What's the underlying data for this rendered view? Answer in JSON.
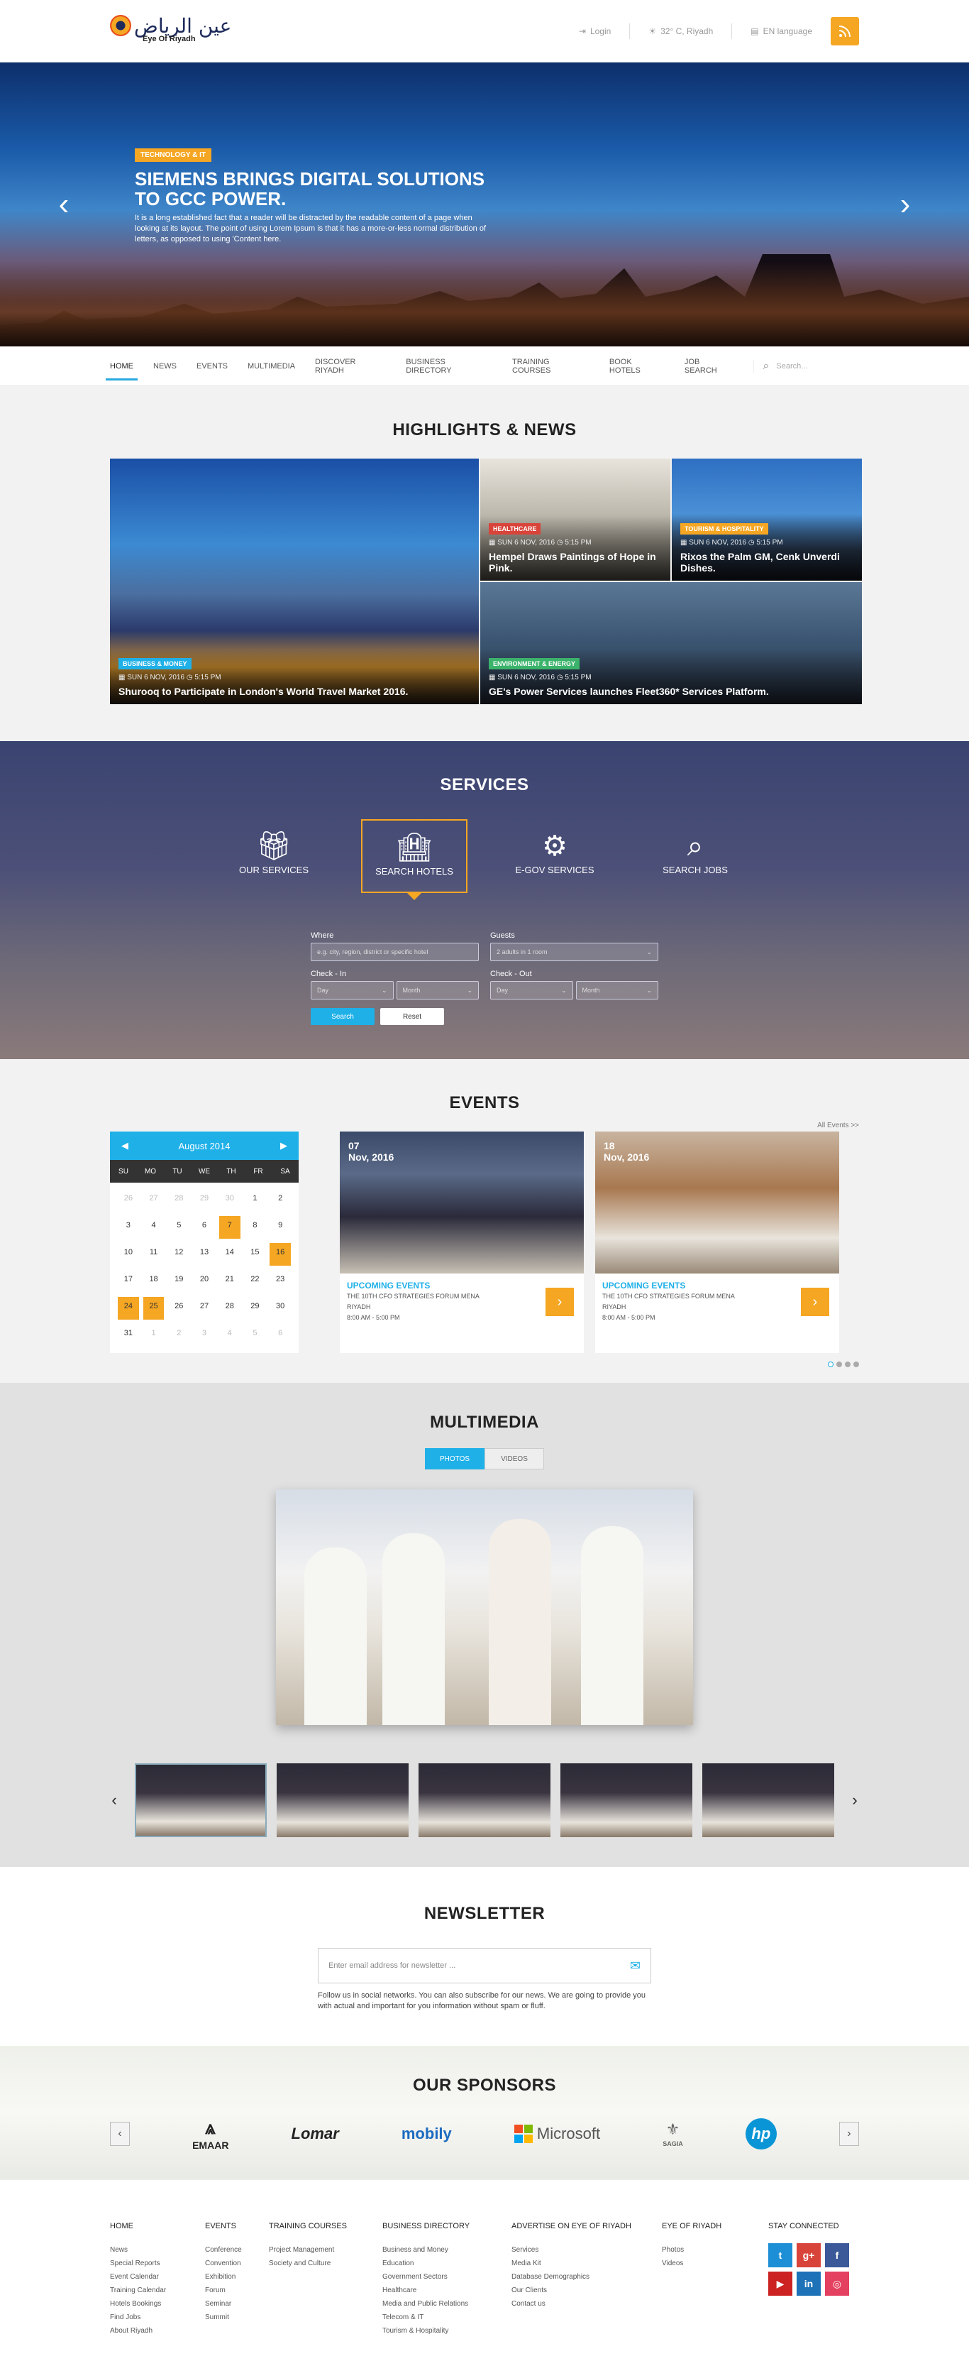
{
  "header": {
    "logo_ar": "عين الرياض",
    "logo_en": "Eye Of Riyadh",
    "login": "Login",
    "weather": "32° C, Riyadh",
    "language": "EN language"
  },
  "hero": {
    "tag": "Technology & IT",
    "title": "Siemens brings digital solutions to GCC power.",
    "text": "It is a long established fact that a reader will be distracted by the readable content of a page when looking at its layout. The point of using Lorem Ipsum is that it has a more-or-less normal distribution of letters, as opposed to using 'Content here."
  },
  "nav": {
    "items": [
      "Home",
      "News",
      "Events",
      "Multimedia",
      "Discover Riyadh",
      "Business Directory",
      "Training Courses",
      "Book Hotels",
      "Job Search"
    ],
    "search_placeholder": "Search..."
  },
  "highlights": {
    "title": "HIGHLIGHTS & NEWS",
    "tiles": [
      {
        "category": "Business & Money",
        "category_color": "#1fb0e8",
        "date": "SUN 6 NOV, 2016",
        "time": "5:15 PM",
        "headline": "Shurooq to Participate in London's World Travel Market 2016."
      },
      {
        "category": "Healthcare",
        "category_color": "#d9443a",
        "date": "SUN 6 NOV, 2016",
        "time": "5:15 PM",
        "headline": "Hempel Draws Paintings of Hope in Pink."
      },
      {
        "category": "Tourism & Hospitality",
        "category_color": "#f5a623",
        "date": "SUN 6 NOV, 2016",
        "time": "5:15 PM",
        "headline": "Rixos the Palm GM, Cenk Unverdi Dishes."
      },
      {
        "category": "Environment & Energy",
        "category_color": "#3bb36b",
        "date": "SUN 6 NOV, 2016",
        "time": "5:15 PM",
        "headline": "GE's Power Services launches Fleet360* Services Platform."
      }
    ]
  },
  "services": {
    "title": "SERVICES",
    "items": [
      "OUR SERVICES",
      "SEARCH HOTELS",
      "E-GOV SERVICES",
      "SEARCH JOBS"
    ],
    "form": {
      "where_label": "Where",
      "where_placeholder": "e.g. city, region, district or specific hotel",
      "guests_label": "Guests",
      "guests_value": "2 adults in 1 room",
      "checkin_label": "Check - In",
      "checkout_label": "Check - Out",
      "day": "Day",
      "month": "Month",
      "search": "Search",
      "reset": "Reset"
    }
  },
  "events": {
    "title": "EVENTS",
    "all_events": "All Events >>",
    "calendar": {
      "month": "August 2014",
      "dow": [
        "SU",
        "MO",
        "TU",
        "WE",
        "TH",
        "FR",
        "SA"
      ],
      "days": [
        "26",
        "27",
        "28",
        "29",
        "30",
        "1",
        "2",
        "3",
        "4",
        "5",
        "6",
        "7",
        "8",
        "9",
        "10",
        "11",
        "12",
        "13",
        "14",
        "15",
        "16",
        "17",
        "18",
        "19",
        "20",
        "21",
        "22",
        "23",
        "24",
        "25",
        "26",
        "27",
        "28",
        "29",
        "30",
        "31",
        "1",
        "2",
        "3",
        "4",
        "5",
        "6"
      ]
    },
    "cards": [
      {
        "date_day": "07",
        "date_rest": "Nov, 2016",
        "label": "UPCOMING EVENTS",
        "name": "THE 10TH CFO STRATEGIES FORUM MENA",
        "city": "RIYADH",
        "time": "8:00 AM - 5:00 PM"
      },
      {
        "date_day": "18",
        "date_rest": "Nov, 2016",
        "label": "UPCOMING EVENTS",
        "name": "THE 10TH CFO STRATEGIES FORUM MENA",
        "city": "RIYADH",
        "time": "8:00 AM - 5:00 PM"
      }
    ]
  },
  "multimedia": {
    "title": "MULTIMEDIA",
    "photos": "PHOTOS",
    "videos": "VIDEOS"
  },
  "newsletter": {
    "title": "NEWSLETTER",
    "placeholder": "Enter email address for newsletter ...",
    "text": "Follow us in social networks. You can also subscribe for our news. We are going to provide you with actual and important for you information without spam or fluff."
  },
  "sponsors": {
    "title": "OUR SPONSORS",
    "logos": [
      "EMAAR",
      "Lomar",
      "mobily",
      "Microsoft",
      "SAGIA",
      "hp"
    ]
  },
  "footer": {
    "cols": [
      {
        "head": "HOME",
        "links": [
          "News",
          "Special Reports",
          "Event Calendar",
          "Training Calendar",
          "Hotels Bookings",
          "Find Jobs",
          "About Riyadh"
        ]
      },
      {
        "head": "EVENTS",
        "links": [
          "Conference",
          "Convention",
          "Exhibition",
          "Forum",
          "Seminar",
          "Summit"
        ]
      },
      {
        "head": "TRAINING COURSES",
        "links": [
          "Project Management",
          "Society and Culture"
        ]
      },
      {
        "head": "BUSINESS DIRECTORY",
        "links": [
          "Business and Money",
          "Education",
          "Government Sectors",
          "Healthcare",
          "Media and Public Relations",
          "Telecom & IT",
          "Tourism & Hospitality"
        ]
      },
      {
        "head": "ADVERTISE ON EYE OF RIYADH",
        "links": [
          "Services",
          "Media Kit",
          "Database Demographics",
          "Our Clients",
          "Contact us"
        ]
      },
      {
        "head": "EYE OF RIYADH",
        "links": [
          "Photos",
          "Videos"
        ]
      }
    ],
    "stay_connected": "STAY CONNECTED",
    "social_icons": [
      "twitter-icon",
      "google-plus-icon",
      "facebook-icon",
      "youtube-icon",
      "linkedin-icon",
      "instagram-icon"
    ],
    "social_colors": [
      "#1d8fd6",
      "#d9443a",
      "#3b5998",
      "#cc2222",
      "#1d72b8",
      "#e4405f"
    ]
  }
}
